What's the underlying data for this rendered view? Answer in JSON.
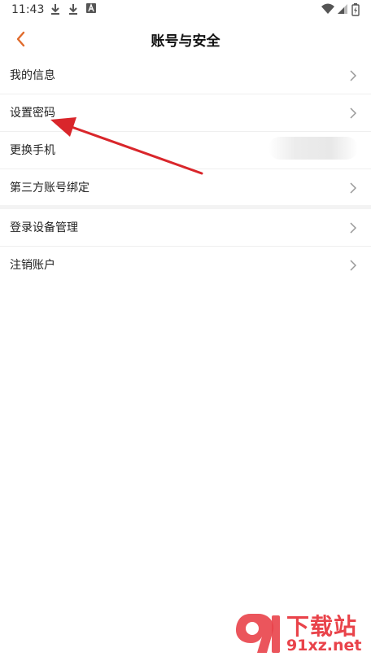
{
  "status_bar": {
    "time": "11:43",
    "left_icons": [
      "download-icon",
      "download-icon",
      "app-notification-icon"
    ],
    "right_icons": [
      "wifi-icon",
      "signal-icon",
      "battery-icon"
    ]
  },
  "header": {
    "title": "账号与安全",
    "back_icon": "chevron-left-icon",
    "accent_color": "#e06a2b"
  },
  "menu_group_1": [
    {
      "label": "我的信息"
    },
    {
      "label": "设置密码"
    },
    {
      "label": "更换手机"
    },
    {
      "label": "第三方账号绑定"
    }
  ],
  "menu_group_2": [
    {
      "label": "登录设备管理"
    },
    {
      "label": "注销账户"
    }
  ],
  "annotation": {
    "arrow_color": "#d9262b",
    "points_to": "设置密码"
  },
  "watermark": {
    "line1": "下载站",
    "line2": "91xz.net",
    "color": "#e9434a"
  }
}
